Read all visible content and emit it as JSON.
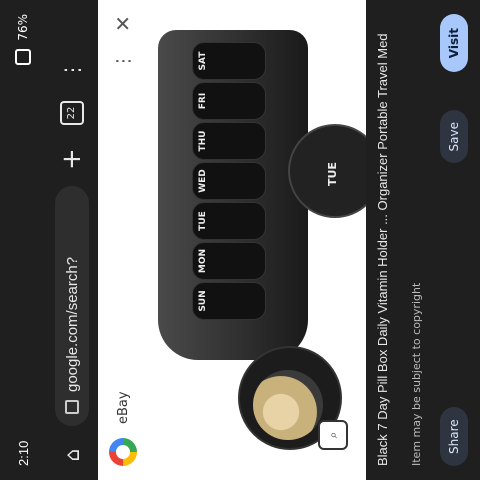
{
  "status": {
    "time": "2:10",
    "battery": "76%"
  },
  "browser": {
    "url": "google.com/search?",
    "tab_count": "22"
  },
  "lens": {
    "source": "eBay"
  },
  "product": {
    "days": [
      "SUN",
      "MON",
      "TUE",
      "WED",
      "THU",
      "FRI",
      "SAT"
    ],
    "lid_day": "TUE",
    "title": "Black 7 Day Pill Box Daily Vitamin Holder ... Organizer Portable Travel Med",
    "subtitle": "Item may be subject to copyright",
    "visit_label": "Visit",
    "save_label": "Save",
    "share_label": "Share"
  }
}
